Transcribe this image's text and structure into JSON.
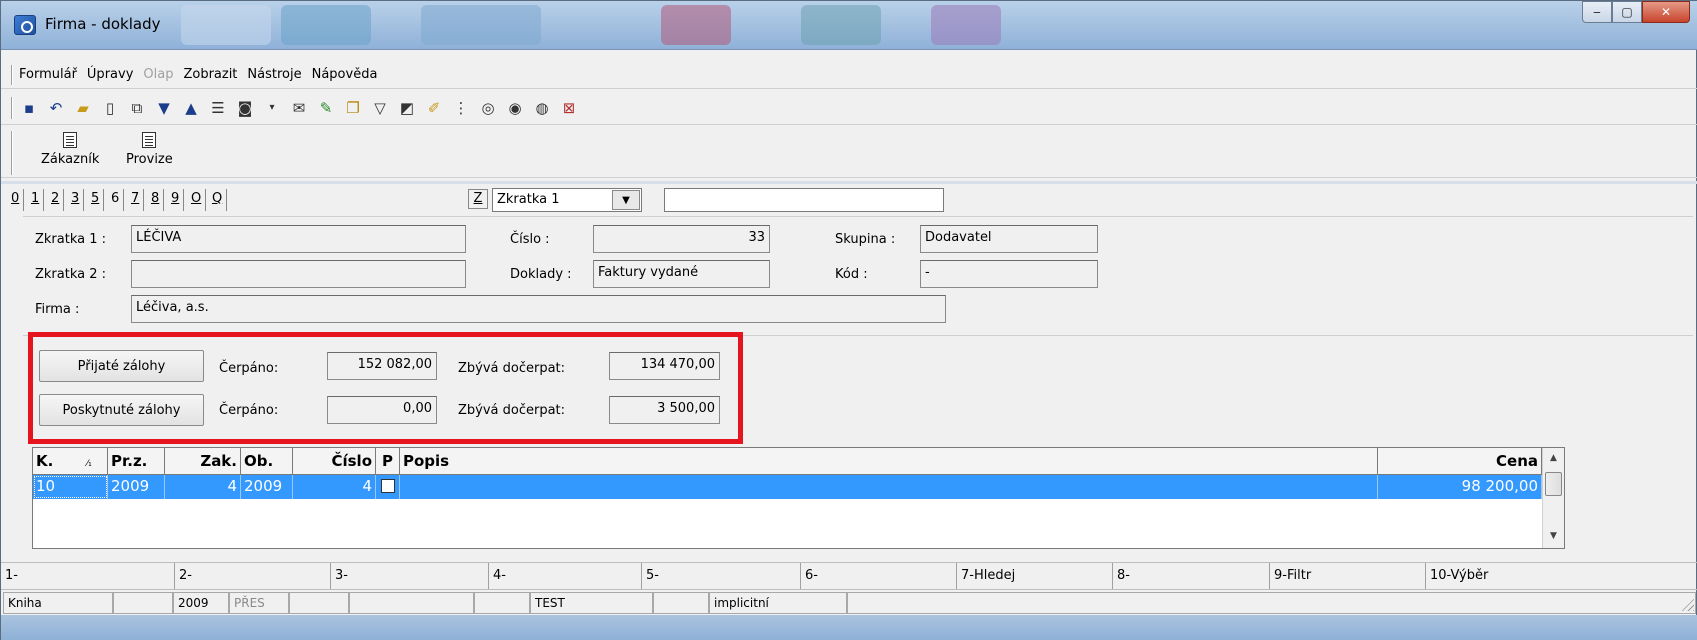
{
  "window": {
    "title": "Firma - doklady",
    "accent": "#3399ff",
    "highlight_border": "#e6141e"
  },
  "menu": [
    "Formulář",
    "Úpravy",
    "Olap",
    "Zobrazit",
    "Nástroje",
    "Nápověda"
  ],
  "menu_disabled": [
    "Olap"
  ],
  "toolbar_icons": [
    "save-icon",
    "undo-icon",
    "open-folder-icon",
    "new-document-icon",
    "copy-icon",
    "arrow-down-icon",
    "arrow-up-icon",
    "properties-icon",
    "camera-icon",
    "dropdown-arrow-icon",
    "mail-icon",
    "wizard-icon",
    "book-icon",
    "filter-icon",
    "filter-edit-icon",
    "edit-folder-icon",
    "tree-icon",
    "binoculars-icon",
    "binoculars-next-icon",
    "binoculars-prev-icon",
    "delete-filter-icon"
  ],
  "big_buttons": {
    "customer": "Zákazník",
    "commission": "Provize"
  },
  "tabs": [
    "0",
    "1",
    "2",
    "3",
    "5",
    "6",
    "7",
    "8",
    "9",
    "O",
    "Q"
  ],
  "sort": {
    "z_label": "Z",
    "combo_value": "Zkratka 1",
    "search_value": ""
  },
  "form": {
    "zkratka1_label": "Zkratka 1 :",
    "zkratka1_value": "LÉČIVA",
    "zkratka2_label": "Zkratka 2 :",
    "zkratka2_value": "",
    "firma_label": "Firma :",
    "firma_value": "Léčiva, a.s.",
    "cislo_label": "Číslo :",
    "cislo_value": "33",
    "doklady_label": "Doklady :",
    "doklady_value": "Faktury vydané",
    "skupina_label": "Skupina :",
    "skupina_value": "Dodavatel",
    "kod_label": "Kód :",
    "kod_value": "-"
  },
  "advances": {
    "received_button": "Přijaté zálohy",
    "provided_button": "Poskytnuté zálohy",
    "cerpano_label": "Čerpáno:",
    "zbyva_label": "Zbývá dočerpat:",
    "received_cerpano": "152 082,00",
    "received_zbyva": "134 470,00",
    "provided_cerpano": "0,00",
    "provided_zbyva": "3 500,00"
  },
  "grid": {
    "headers": {
      "k": "K.",
      "k_sort": "⁄₁",
      "prz": "Pr.z.",
      "zak": "Zak.",
      "ob": "Ob.",
      "cislo": "Číslo",
      "p": "P",
      "popis": "Popis",
      "cena": "Cena"
    },
    "row": {
      "k": "10",
      "prz": "2009",
      "zak": "4",
      "ob": "2009",
      "cislo": "4",
      "popis": "",
      "cena": "98 200,00"
    }
  },
  "fkeys": [
    "1-",
    "2-",
    "3-",
    "4-",
    "5-",
    "6-",
    "7-Hledej",
    "8-",
    "9-Filtr",
    "10-Výběr"
  ],
  "status": {
    "s1": "Kniha",
    "s2": "",
    "s3": "2009",
    "s4": "PŘES",
    "s5": "",
    "s6": "",
    "s7": "",
    "s8": "TEST",
    "s9": "",
    "s10": "implicitní",
    "s11": ""
  }
}
